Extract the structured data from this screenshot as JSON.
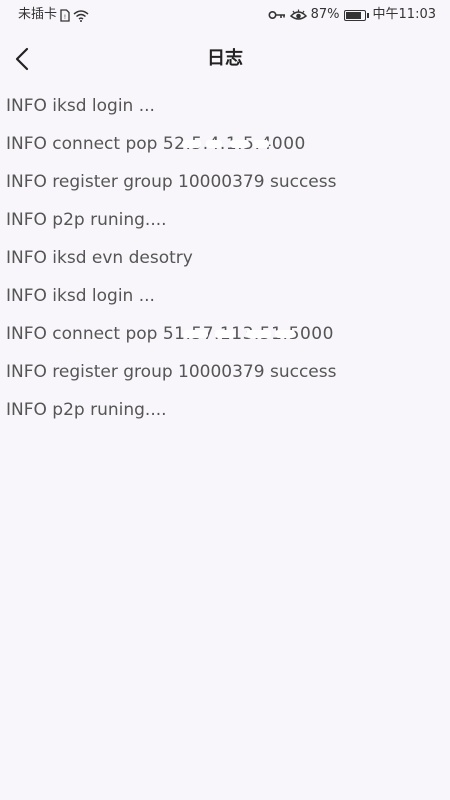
{
  "status_bar": {
    "carrier": "未插卡",
    "battery_percent": "87%",
    "battery_level": 0.87,
    "time": "中午11:03",
    "icons": [
      "sim-icon",
      "wifi-icon",
      "key-icon",
      "eye-icon",
      "battery-icon"
    ]
  },
  "header": {
    "title": "日志",
    "back_icon": "chevron-left-icon"
  },
  "log": {
    "lines": [
      {
        "text": "INFO iksd login ..."
      },
      {
        "text": "INFO connect pop ",
        "ip": "52.5.4.1.5:4000"
      },
      {
        "text": "INFO register group 10000379 success"
      },
      {
        "text": "INFO p2p runing...."
      },
      {
        "text": "INFO iksd evn desotry"
      },
      {
        "text": "INFO iksd login ..."
      },
      {
        "text": "INFO connect pop ",
        "ip": "51.57.113.51:5000"
      },
      {
        "text": "INFO register group 10000379 success"
      },
      {
        "text": "INFO p2p runing...."
      }
    ]
  },
  "colors": {
    "background": "#f8f6fa",
    "text": "#555555",
    "title": "#222222"
  }
}
